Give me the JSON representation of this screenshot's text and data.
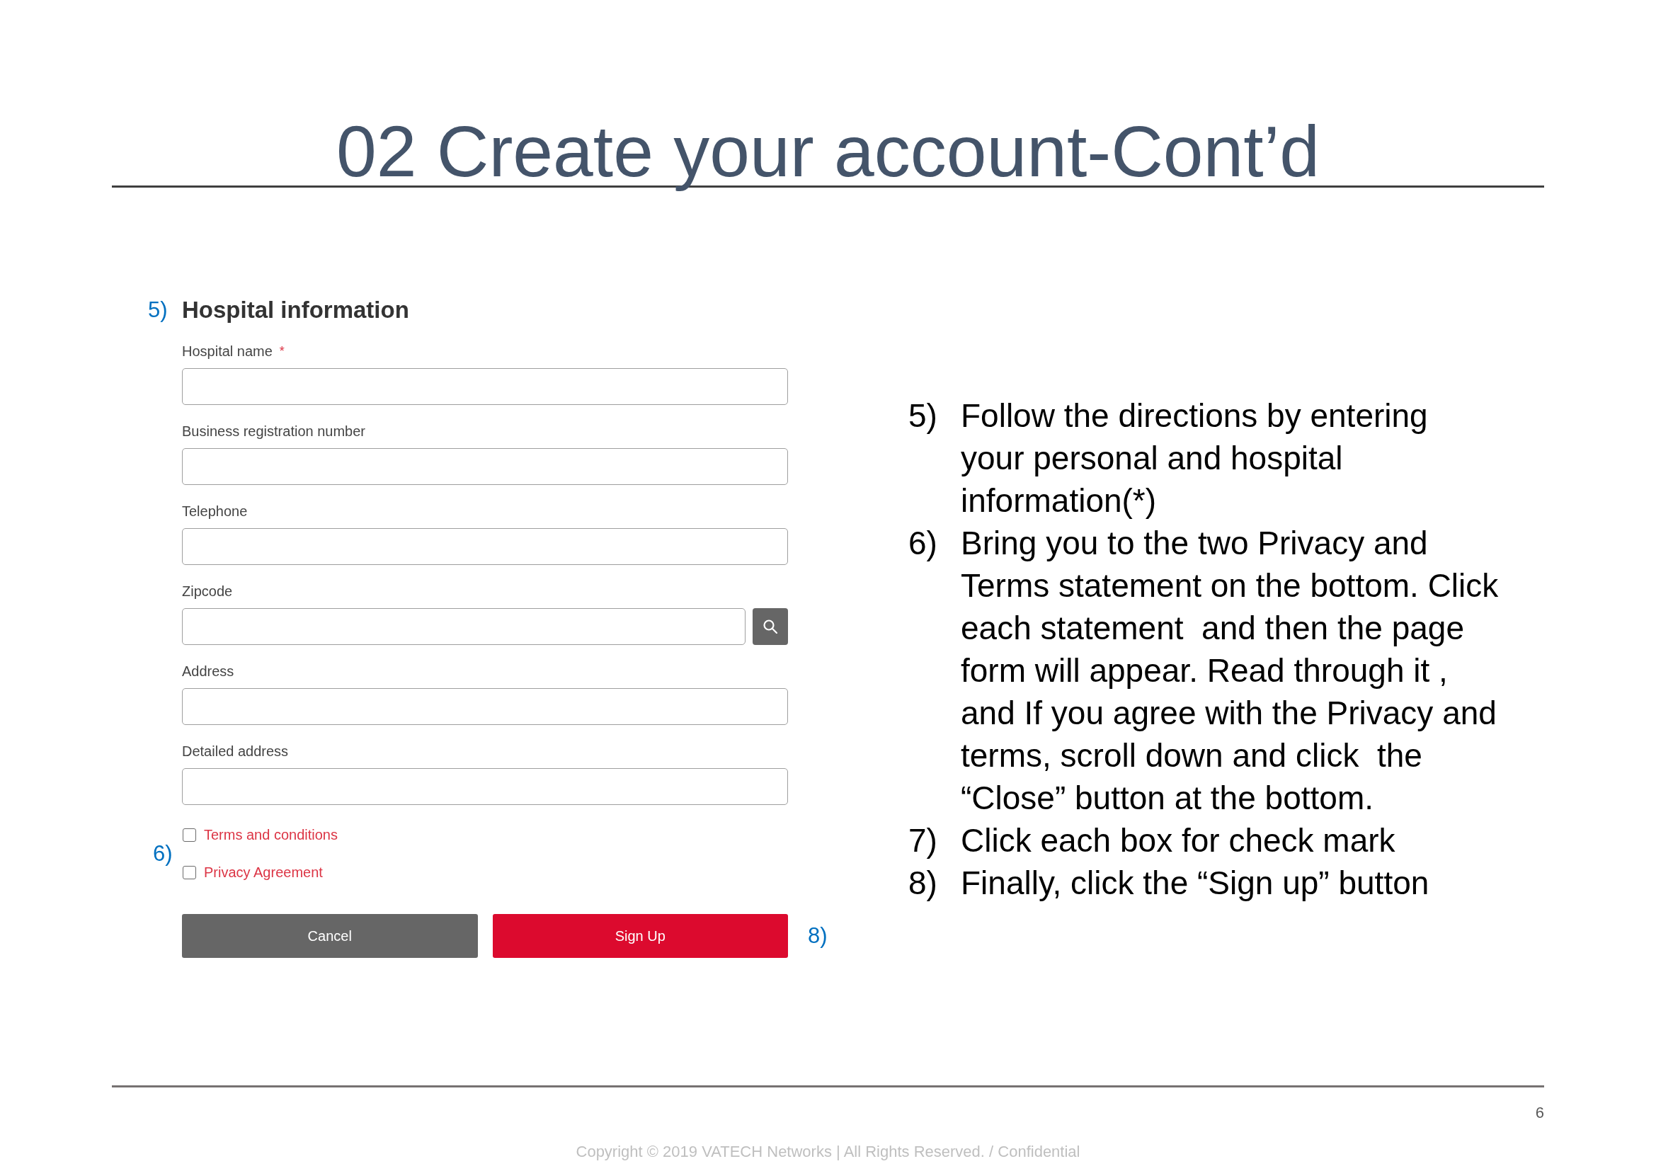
{
  "title": "02 Create your account-Cont’d",
  "form": {
    "step_marker": "5)",
    "heading": "Hospital information",
    "fields": [
      {
        "label": "Hospital name",
        "required_mark": "*",
        "kind": "text"
      },
      {
        "label": "Business registration number",
        "kind": "text"
      },
      {
        "label": "Telephone",
        "kind": "text"
      },
      {
        "label": "Zipcode",
        "kind": "search"
      },
      {
        "label": "Address",
        "kind": "text"
      },
      {
        "label": "Detailed address",
        "kind": "text"
      }
    ],
    "agreements_step_marker": "6)",
    "agreements": [
      {
        "label": "Terms and conditions",
        "checked": false
      },
      {
        "label": "Privacy Agreement",
        "checked": false
      }
    ],
    "buttons": [
      {
        "label": "Cancel",
        "kind": "secondary"
      },
      {
        "label": "Sign Up",
        "kind": "primary"
      }
    ],
    "buttons_step_marker": "8)"
  },
  "instructions": [
    {
      "number": "5)",
      "lines": [
        "Follow the directions by entering",
        "your personal and hospital",
        "information(*)"
      ]
    },
    {
      "number": "6)",
      "lines": [
        "Bring you to the two Privacy and",
        "Terms statement on the bottom. Click",
        "each statement  and then the page",
        "form will appear. Read through it ,",
        "and If you agree with the Privacy and",
        "terms, scroll down and click  the",
        "“Close” button at the bottom."
      ]
    },
    {
      "number": "7)",
      "lines": [
        "Click each box for check mark"
      ]
    },
    {
      "number": "8)",
      "lines": [
        "Finally, click the “Sign up” button"
      ]
    }
  ],
  "footer": {
    "page_number": "6",
    "copyright": "Copyright © 2019 VATECH Networks | All Rights Reserved. / Confidential"
  }
}
